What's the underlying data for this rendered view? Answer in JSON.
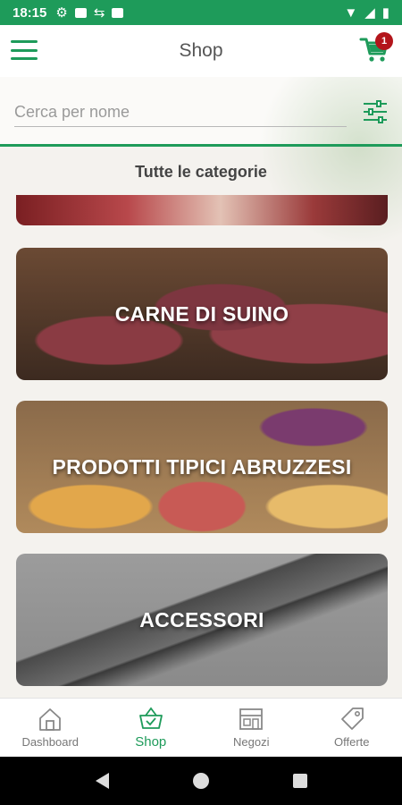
{
  "status_bar": {
    "time": "18:15"
  },
  "app_bar": {
    "title": "Shop",
    "cart_count": "1"
  },
  "search": {
    "placeholder": "Cerca per nome"
  },
  "categories_header": "Tutte le categorie",
  "categories": [
    {
      "label": ""
    },
    {
      "label": "CARNE DI SUINO"
    },
    {
      "label": "PRODOTTI TIPICI ABRUZZESI"
    },
    {
      "label": "ACCESSORI"
    }
  ],
  "bottom_nav": [
    {
      "label": "Dashboard",
      "icon": "home-icon",
      "active": false
    },
    {
      "label": "Shop",
      "icon": "basket-icon",
      "active": true
    },
    {
      "label": "Negozi",
      "icon": "store-icon",
      "active": false
    },
    {
      "label": "Offerte",
      "icon": "tag-icon",
      "active": false
    }
  ],
  "colors": {
    "accent": "#1e9b5a",
    "badge": "#b3151b"
  }
}
